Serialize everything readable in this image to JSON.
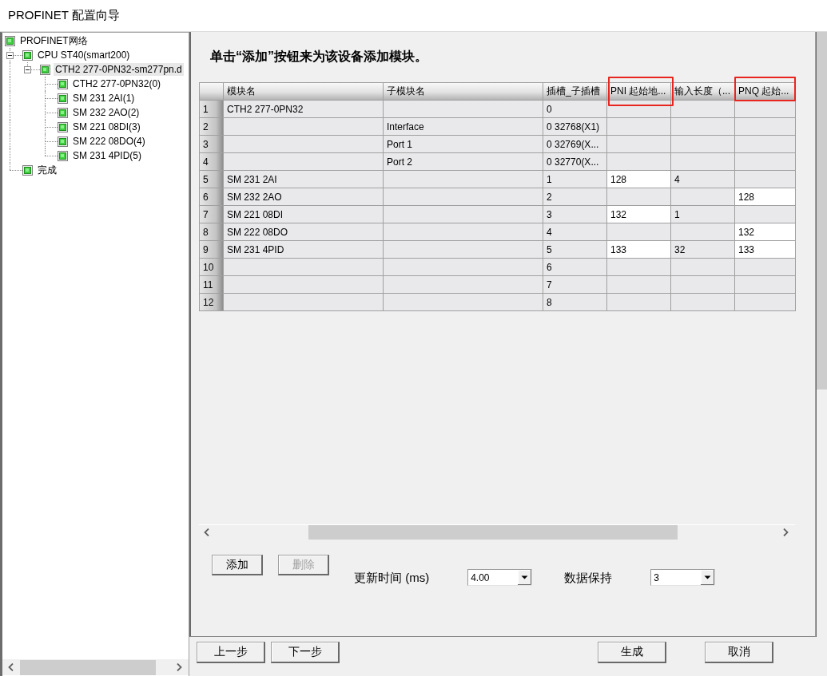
{
  "window": {
    "title": "PROFINET 配置向导"
  },
  "tree": {
    "items": [
      {
        "label": "PROFINET网络",
        "selected": false,
        "children": [
          {
            "label": "CPU ST40(smart200)",
            "selected": false,
            "expanded": true,
            "children": [
              {
                "label": "CTH2 277-0PN32-sm277pn.d",
                "selected": true,
                "expanded": true,
                "children": [
                  {
                    "label": "CTH2 277-0PN32(0)",
                    "selected": false
                  },
                  {
                    "label": "SM 231 2AI(1)",
                    "selected": false
                  },
                  {
                    "label": "SM 232 2AO(2)",
                    "selected": false
                  },
                  {
                    "label": "SM 221 08DI(3)",
                    "selected": false
                  },
                  {
                    "label": "SM 222 08DO(4)",
                    "selected": false
                  },
                  {
                    "label": "SM 231 4PID(5)",
                    "selected": false
                  }
                ]
              }
            ]
          },
          {
            "label": "完成",
            "selected": false
          }
        ]
      }
    ]
  },
  "instruction": "单击“添加”按钮来为该设备添加模块。",
  "table": {
    "columns": [
      {
        "label": "模块名",
        "highlighted": false,
        "editable": false
      },
      {
        "label": "子模块名",
        "highlighted": false,
        "editable": false
      },
      {
        "label": "插槽_子插槽",
        "highlighted": false,
        "editable": false
      },
      {
        "label": "PNI 起始地...",
        "highlighted": true,
        "editable": true
      },
      {
        "label": "输入长度（...",
        "highlighted": false,
        "editable": false
      },
      {
        "label": "PNQ 起始...",
        "highlighted": true,
        "editable": true
      }
    ],
    "rows": [
      {
        "number": "1",
        "module": "CTH2 277-0PN32",
        "slot": "0"
      },
      {
        "number": "2",
        "submodule": "Interface",
        "slot": "0 32768(X1)"
      },
      {
        "number": "3",
        "submodule": "Port 1",
        "slot": "0 32769(X..."
      },
      {
        "number": "4",
        "submodule": "Port 2",
        "slot": "0 32770(X..."
      },
      {
        "number": "5",
        "module": "SM 231 2AI",
        "slot": "1",
        "pni_start": "128",
        "input_length": "4"
      },
      {
        "number": "6",
        "module": "SM 232 2AO",
        "slot": "2",
        "pnq_start": "128"
      },
      {
        "number": "7",
        "module": "SM 221 08DI",
        "slot": "3",
        "pni_start": "132",
        "input_length": "1"
      },
      {
        "number": "8",
        "module": "SM 222 08DO",
        "slot": "4",
        "pnq_start": "132"
      },
      {
        "number": "9",
        "module": "SM 231 4PID",
        "slot": "5",
        "pni_start": "133",
        "input_length": "32",
        "pnq_start": "133"
      },
      {
        "number": "10",
        "slot": "6"
      },
      {
        "number": "11",
        "slot": "7"
      },
      {
        "number": "12",
        "slot": "8"
      }
    ]
  },
  "table_buttons": [
    {
      "label": "添加",
      "disabled": false
    },
    {
      "label": "删除",
      "disabled": true
    }
  ],
  "settings": [
    {
      "label": "更新时间 (ms)",
      "value": "4.00"
    },
    {
      "label": "数据保持",
      "value": "3"
    }
  ],
  "step_buttons": [
    {
      "label": "上一步"
    },
    {
      "label": "下一步"
    }
  ],
  "dialog_buttons": [
    {
      "label": "生成"
    },
    {
      "label": "取消"
    }
  ]
}
